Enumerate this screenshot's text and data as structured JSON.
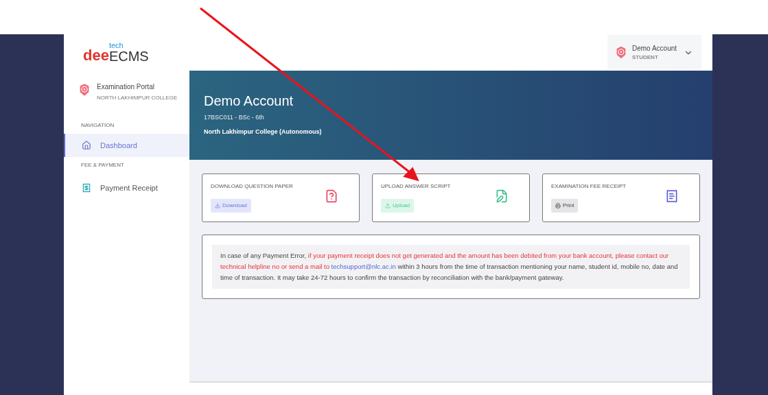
{
  "logo": {
    "prefix": "dee",
    "superscript": "tech",
    "name": "ECMS"
  },
  "user_menu": {
    "name": "Demo Account",
    "role": "STUDENT"
  },
  "sidebar": {
    "portal_title": "Examination Portal",
    "portal_subtitle": "NORTH LAKHIMPUR COLLEGE",
    "sections": [
      {
        "heading": "NAVIGATION",
        "items": [
          {
            "label": "Dashboard",
            "kind": "home",
            "selected": true
          }
        ]
      },
      {
        "heading": "FEE & PAYMENT",
        "items": [
          {
            "label": "Payment Receipt",
            "kind": "receipt",
            "selected": false
          }
        ]
      }
    ]
  },
  "banner": {
    "name": "Demo Account",
    "details": "17BSC011 - BSc - 6th",
    "college": "North Lakhimpur College (Autonomous)"
  },
  "cards": [
    {
      "title": "DOWNLOAD QUESTION PAPER",
      "button": "Download",
      "kind": "download"
    },
    {
      "title": "UPLOAD ANSWER SCRIPT",
      "button": "Upload",
      "kind": "upload"
    },
    {
      "title": "EXAMINATION FEE RECEIPT",
      "button": "Print",
      "kind": "print"
    }
  ],
  "notice": {
    "intro": "In case of any Payment Error,",
    "warning": "if your payment receipt does not get generated and the amount has been debited from your bank account, please contact our technical helpline no or send a mail to",
    "email": "techsupport@nlc.ac.in",
    "rest": "within 3 hours from the time of transaction mentioning your name, student id, mobile no, date and time of transaction. It may take 24-72 hours to confirm the transaction by reconciliation with the bank/payment gateway."
  }
}
